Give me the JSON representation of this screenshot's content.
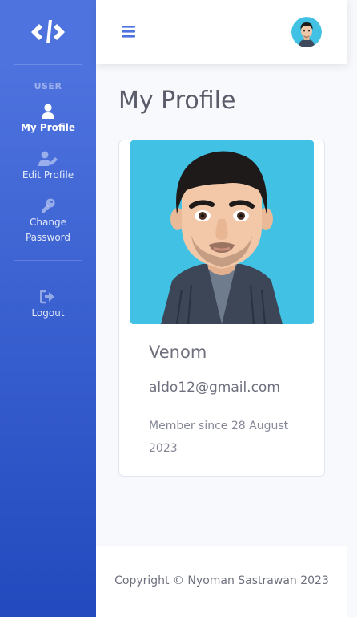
{
  "sidebar": {
    "heading": "USER",
    "items": [
      {
        "label": "My Profile",
        "icon": "user-icon",
        "active": true
      },
      {
        "label": "Edit Profile",
        "icon": "user-edit-icon",
        "active": false
      },
      {
        "label": "Change Password",
        "icon": "key-icon",
        "active": false
      }
    ],
    "logout": {
      "label": "Logout",
      "icon": "logout-icon"
    }
  },
  "topbar": {
    "menu_icon": "hamburger-icon",
    "avatar": "avatar"
  },
  "page": {
    "title": "My Profile"
  },
  "profile": {
    "name": "Venom",
    "email": "aldo12@gmail.com",
    "member_since": "Member since 28 August 2023"
  },
  "footer": {
    "copyright": "Copyright © Nyoman Sastrawan 2023"
  },
  "colors": {
    "sidebar_top": "#4e73df",
    "sidebar_bottom": "#224abe",
    "photo_bg": "#41c2e4",
    "content_bg": "#f8f9fc"
  }
}
